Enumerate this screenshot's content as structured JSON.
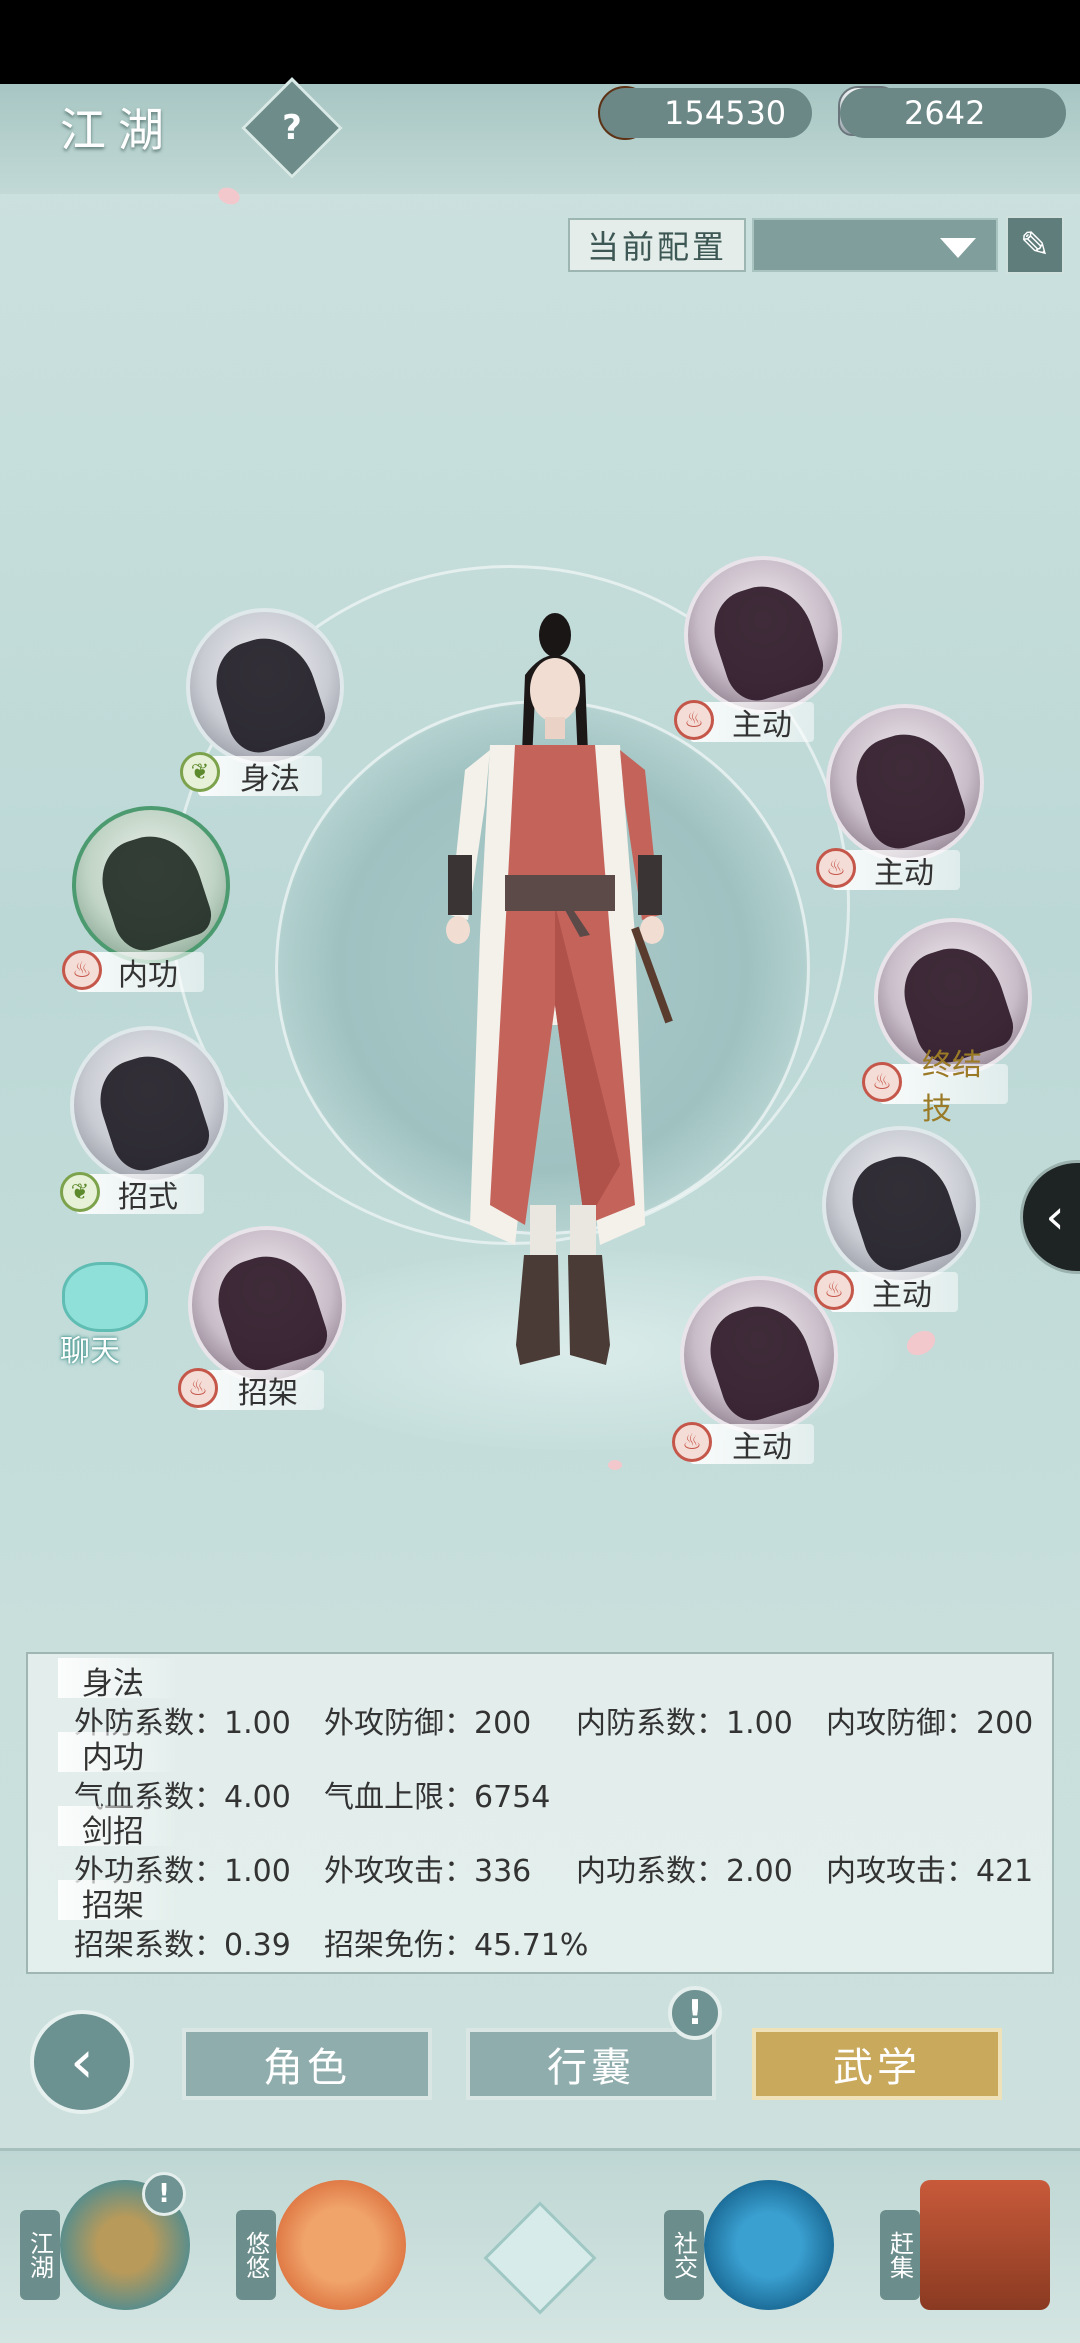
{
  "header": {
    "title": "江湖",
    "help_icon": "?",
    "copper": "154530",
    "silver": "2642"
  },
  "config": {
    "label": "当前配置",
    "selected": ""
  },
  "skills": {
    "left": [
      {
        "label": "身法",
        "badge": "leaf"
      },
      {
        "label": "内功",
        "badge": "fire"
      },
      {
        "label": "招式",
        "badge": "leaf"
      },
      {
        "label": "招架",
        "badge": "fire"
      }
    ],
    "right": [
      {
        "label": "主动",
        "badge": "fire"
      },
      {
        "label": "主动",
        "badge": "fire"
      },
      {
        "label": "终结技",
        "badge": "fire"
      },
      {
        "label": "主动",
        "badge": "fire"
      },
      {
        "label": "主动",
        "badge": "fire"
      }
    ]
  },
  "chat": {
    "label": "聊天"
  },
  "stats": {
    "shenfa": {
      "title": "身法",
      "items": [
        "外防系数：1.00",
        "外攻防御：200",
        "内防系数：1.00",
        "内攻防御：200"
      ]
    },
    "neigong": {
      "title": "内功",
      "items": [
        "气血系数：4.00",
        "气血上限：6754"
      ]
    },
    "jianzhao": {
      "title": "剑招",
      "items": [
        "外功系数：1.00",
        "外攻攻击：336",
        "内功系数：2.00",
        "内攻攻击：421"
      ]
    },
    "zhaojia": {
      "title": "招架",
      "items": [
        "招架系数：0.39",
        "招架免伤：45.71%"
      ]
    }
  },
  "tabs": {
    "role": "角色",
    "bag": "行囊",
    "martial": "武学",
    "alert": "!"
  },
  "nav": {
    "jianghu": "江湖",
    "youyou": "悠悠",
    "shejiao": "社交",
    "ganji": "赶集",
    "alert": "!"
  },
  "colors": {
    "active_tab": "#c9a95b",
    "plain_tab": "#8fadac",
    "fire_badge": "#c5564a",
    "leaf_badge": "#7ca34c"
  }
}
